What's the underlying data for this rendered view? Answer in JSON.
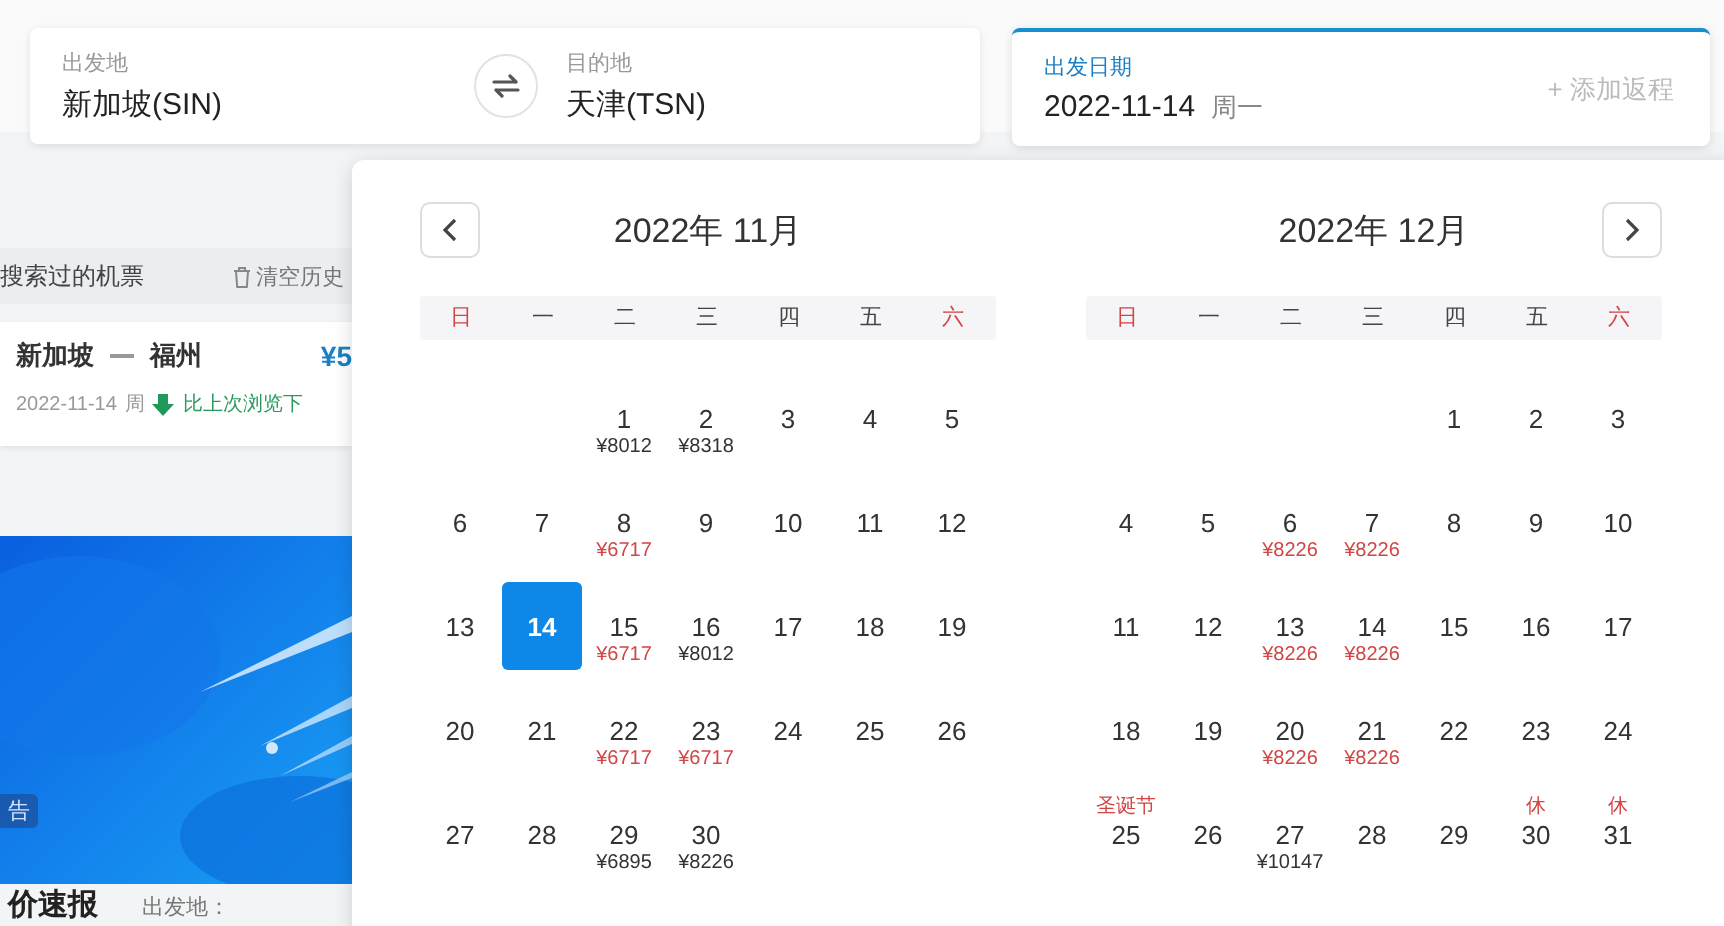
{
  "search": {
    "from": {
      "label": "出发地",
      "value": "新加坡(SIN)"
    },
    "to": {
      "label": "目的地",
      "value": "天津(TSN)"
    },
    "date": {
      "label": "出发日期",
      "value": "2022-11-14",
      "weekday": "周一",
      "add_return": "+ 添加返程"
    }
  },
  "history": {
    "title": "搜索过的机票",
    "clear": "清空历史",
    "items": [
      {
        "from": "新加坡",
        "to": "福州",
        "price": "¥5",
        "date": "2022-11-14",
        "weekday": "周",
        "trend": "比上次浏览下"
      }
    ]
  },
  "ad": {
    "kind": "picture",
    "tag": "告"
  },
  "deals": {
    "title": "价速报",
    "field": "出发地："
  },
  "calendar": {
    "months": [
      {
        "title": "2022年 11月",
        "kind": "prev",
        "weekdays": [
          {
            "label": "日",
            "weekend": true
          },
          {
            "label": "一",
            "weekend": false
          },
          {
            "label": "二",
            "weekend": false
          },
          {
            "label": "三",
            "weekend": false
          },
          {
            "label": "四",
            "weekend": false
          },
          {
            "label": "五",
            "weekend": false
          },
          {
            "label": "六",
            "weekend": true
          }
        ],
        "weeks": [
          [
            {
              "kind": "blank"
            },
            {
              "kind": "blank"
            },
            {
              "kind": "day",
              "day": "1",
              "price": "¥8012",
              "low": false,
              "selected": false
            },
            {
              "kind": "day",
              "day": "2",
              "price": "¥8318",
              "low": false,
              "selected": false
            },
            {
              "kind": "day",
              "day": "3",
              "selected": false
            },
            {
              "kind": "day",
              "day": "4",
              "selected": false
            },
            {
              "kind": "day",
              "day": "5",
              "selected": false
            }
          ],
          [
            {
              "kind": "day",
              "day": "6",
              "selected": false
            },
            {
              "kind": "day",
              "day": "7",
              "selected": false
            },
            {
              "kind": "day",
              "day": "8",
              "price": "¥6717",
              "low": true,
              "selected": false
            },
            {
              "kind": "day",
              "day": "9",
              "selected": false
            },
            {
              "kind": "day",
              "day": "10",
              "selected": false
            },
            {
              "kind": "day",
              "day": "11",
              "selected": false
            },
            {
              "kind": "day",
              "day": "12",
              "selected": false
            }
          ],
          [
            {
              "kind": "day",
              "day": "13",
              "selected": false
            },
            {
              "kind": "day",
              "day": "14",
              "selected": true
            },
            {
              "kind": "day",
              "day": "15",
              "price": "¥6717",
              "low": true,
              "selected": false
            },
            {
              "kind": "day",
              "day": "16",
              "price": "¥8012",
              "low": false,
              "selected": false
            },
            {
              "kind": "day",
              "day": "17",
              "selected": false
            },
            {
              "kind": "day",
              "day": "18",
              "selected": false
            },
            {
              "kind": "day",
              "day": "19",
              "selected": false
            }
          ],
          [
            {
              "kind": "day",
              "day": "20",
              "selected": false
            },
            {
              "kind": "day",
              "day": "21",
              "selected": false
            },
            {
              "kind": "day",
              "day": "22",
              "price": "¥6717",
              "low": true,
              "selected": false
            },
            {
              "kind": "day",
              "day": "23",
              "price": "¥6717",
              "low": true,
              "selected": false
            },
            {
              "kind": "day",
              "day": "24",
              "selected": false
            },
            {
              "kind": "day",
              "day": "25",
              "selected": false
            },
            {
              "kind": "day",
              "day": "26",
              "selected": false
            }
          ],
          [
            {
              "kind": "day",
              "day": "27",
              "selected": false
            },
            {
              "kind": "day",
              "day": "28",
              "selected": false
            },
            {
              "kind": "day",
              "day": "29",
              "price": "¥6895",
              "low": false,
              "selected": false
            },
            {
              "kind": "day",
              "day": "30",
              "price": "¥8226",
              "low": false,
              "selected": false
            },
            {
              "kind": "blank"
            },
            {
              "kind": "blank"
            },
            {
              "kind": "blank"
            }
          ]
        ]
      },
      {
        "title": "2022年 12月",
        "kind": "next",
        "weekdays": [
          {
            "label": "日",
            "weekend": true
          },
          {
            "label": "一",
            "weekend": false
          },
          {
            "label": "二",
            "weekend": false
          },
          {
            "label": "三",
            "weekend": false
          },
          {
            "label": "四",
            "weekend": false
          },
          {
            "label": "五",
            "weekend": false
          },
          {
            "label": "六",
            "weekend": true
          }
        ],
        "weeks": [
          [
            {
              "kind": "blank"
            },
            {
              "kind": "blank"
            },
            {
              "kind": "blank"
            },
            {
              "kind": "blank"
            },
            {
              "kind": "day",
              "day": "1",
              "selected": false
            },
            {
              "kind": "day",
              "day": "2",
              "selected": false
            },
            {
              "kind": "day",
              "day": "3",
              "selected": false
            }
          ],
          [
            {
              "kind": "day",
              "day": "4",
              "selected": false
            },
            {
              "kind": "day",
              "day": "5",
              "selected": false
            },
            {
              "kind": "day",
              "day": "6",
              "price": "¥8226",
              "low": true,
              "selected": false
            },
            {
              "kind": "day",
              "day": "7",
              "price": "¥8226",
              "low": true,
              "selected": false
            },
            {
              "kind": "day",
              "day": "8",
              "selected": false
            },
            {
              "kind": "day",
              "day": "9",
              "selected": false
            },
            {
              "kind": "day",
              "day": "10",
              "selected": false
            }
          ],
          [
            {
              "kind": "day",
              "day": "11",
              "selected": false
            },
            {
              "kind": "day",
              "day": "12",
              "selected": false
            },
            {
              "kind": "day",
              "day": "13",
              "price": "¥8226",
              "low": true,
              "selected": false
            },
            {
              "kind": "day",
              "day": "14",
              "price": "¥8226",
              "low": true,
              "selected": false
            },
            {
              "kind": "day",
              "day": "15",
              "selected": false
            },
            {
              "kind": "day",
              "day": "16",
              "selected": false
            },
            {
              "kind": "day",
              "day": "17",
              "selected": false
            }
          ],
          [
            {
              "kind": "day",
              "day": "18",
              "selected": false
            },
            {
              "kind": "day",
              "day": "19",
              "selected": false
            },
            {
              "kind": "day",
              "day": "20",
              "price": "¥8226",
              "low": true,
              "selected": false
            },
            {
              "kind": "day",
              "day": "21",
              "price": "¥8226",
              "low": true,
              "selected": false
            },
            {
              "kind": "day",
              "day": "22",
              "selected": false
            },
            {
              "kind": "day",
              "day": "23",
              "selected": false
            },
            {
              "kind": "day",
              "day": "24",
              "selected": false
            }
          ],
          [
            {
              "kind": "day",
              "day": "25",
              "holiday": "圣诞节",
              "selected": false
            },
            {
              "kind": "day",
              "day": "26",
              "selected": false
            },
            {
              "kind": "day",
              "day": "27",
              "price": "¥10147",
              "low": false,
              "selected": false
            },
            {
              "kind": "day",
              "day": "28",
              "selected": false
            },
            {
              "kind": "day",
              "day": "29",
              "selected": false
            },
            {
              "kind": "day",
              "day": "30",
              "holiday": "休",
              "selected": false
            },
            {
              "kind": "day",
              "day": "31",
              "holiday": "休",
              "selected": false
            }
          ]
        ]
      }
    ]
  }
}
